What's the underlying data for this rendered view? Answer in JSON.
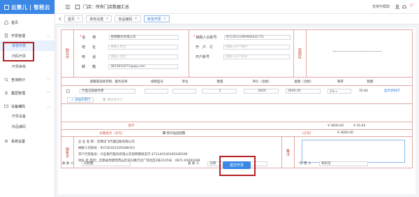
{
  "app": {
    "brand": "云票儿 | 智税云"
  },
  "topbar": {
    "store_label": "门店：所有门店数据汇总",
    "support": "支持与帮助",
    "notif_count": "37"
  },
  "sidebar": {
    "items": [
      {
        "label": "首页"
      },
      {
        "label": "开票管理"
      },
      {
        "label": "单张开票"
      },
      {
        "label": "扫码开票"
      },
      {
        "label": "开票审核"
      },
      {
        "label": "查询统计"
      },
      {
        "label": "集团管理"
      },
      {
        "label": "设备编码"
      },
      {
        "label": "开票设备"
      },
      {
        "label": "商品编码"
      },
      {
        "label": "系统设置"
      }
    ]
  },
  "tabs": [
    {
      "label": "首页"
    },
    {
      "label": "系统设置"
    },
    {
      "label": "商品编码"
    },
    {
      "label": "单张开票"
    }
  ],
  "buyer": {
    "section_label": "购买方",
    "name_label": "名　　称",
    "name_value": "昆明蝶讯有限公司",
    "address_label": "地　　址",
    "address_placeholder": "请输入地址",
    "phone_label": "电　　话",
    "phone_placeholder": "请输入电话",
    "email_label": "邮　　箱",
    "email_value": "3653652072@qq.com",
    "taxid_label": "纳税人识别号",
    "taxid_value": "91530111MA6NULEC7G",
    "bank_label": "开　户　行",
    "bank_placeholder": "请输入开户银行",
    "account_label": "开户账号",
    "account_placeholder": "请输入开户账号",
    "password_label": "密码区"
  },
  "items_table": {
    "headers": [
      "请输或选择货物、服务名称",
      "规格型号",
      "单位",
      "数量",
      "单价（含税）",
      "金额（含税）",
      "税率",
      "税额",
      ""
    ],
    "row": {
      "name": "代理记账服务费",
      "qty": "1",
      "price": "3600",
      "amount": "3600.00",
      "rate": "1%",
      "tax": "35.64",
      "action": "显示折扣行"
    },
    "add_row": "添加开票行",
    "delete_row": "删除选中行"
  },
  "totals": {
    "sum_label": "合计",
    "amount_total": "¥ 3600.00",
    "tax_total": "¥ 35.64",
    "total_label": "价税合计（大写）",
    "total_words": "叁仟陆佰圆整",
    "small_label": "(小写)",
    "small_value": "¥ 3600.00"
  },
  "seller": {
    "section_label": "销售方",
    "name_label": "企 业 名 称：",
    "name_value": "云南讯飞代理记账有限公司",
    "taxid_label": "纳税人识别号：",
    "taxid_value": "91530102329188H10",
    "bank_label": "开户行及账号：",
    "bank_value": "兴业银行股份有限公司昆明南屏支行 471140100100189209",
    "address_label": "地址 及 电话：",
    "address_value": "云南省昆明市西山区前兴路万达广场北区2栋2105号　0871-65091084",
    "remarks_label": "备注"
  },
  "signers": {
    "payee_label": "收 款 人",
    "payee_value": "刘碧娥",
    "reviewer_label": "复 核 人",
    "reviewer_value": "马明",
    "issuer_label": "开 票 人",
    "issuer_value": "和科莹"
  },
  "submit": {
    "label": "提交开票"
  },
  "colors": {
    "primary": "#3a87e6",
    "highlight": "#b72025",
    "invoice_border": "#e2a9a5",
    "invoice_label": "#c0392b"
  }
}
